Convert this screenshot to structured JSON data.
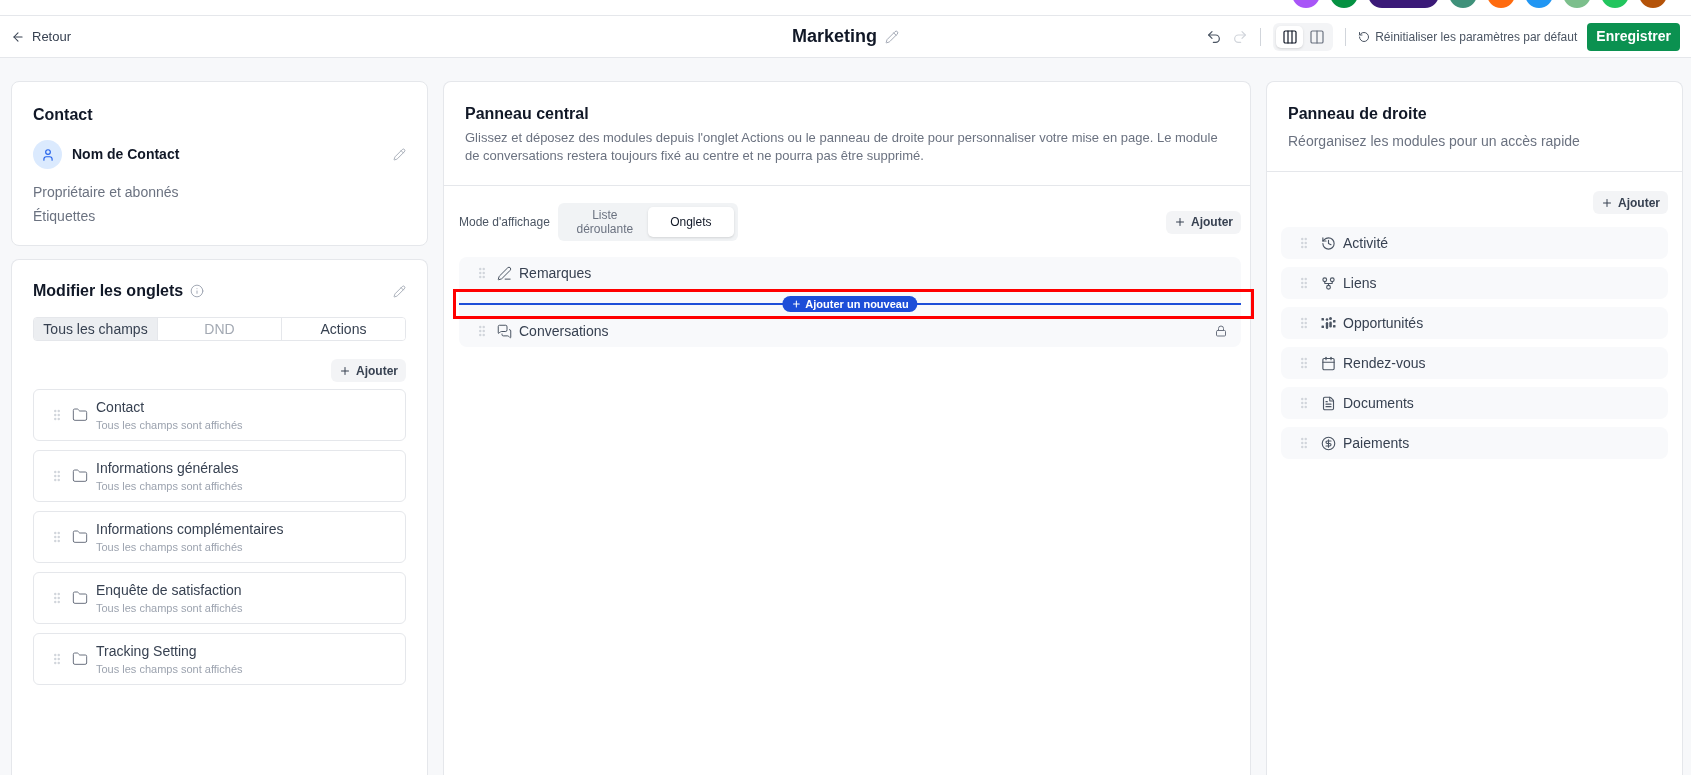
{
  "top_strip": {
    "swatches": [
      {
        "kind": "circle",
        "color": "#a855f7"
      },
      {
        "kind": "circle",
        "color": "#059142"
      },
      {
        "kind": "pill",
        "color": "#3b1a78"
      },
      {
        "kind": "circle",
        "color": "#3f917a"
      },
      {
        "kind": "circle",
        "color": "#ff6b0f"
      },
      {
        "kind": "circle",
        "color": "#2196f3"
      },
      {
        "kind": "circle",
        "color": "#7cbf8c"
      },
      {
        "kind": "circle",
        "color": "#22c55e"
      },
      {
        "kind": "circle",
        "color": "#b45309"
      }
    ]
  },
  "header": {
    "back_label": "Retour",
    "title": "Marketing",
    "history": [
      {
        "kind": "undo",
        "disabled": false
      },
      {
        "kind": "redo",
        "disabled": true
      }
    ],
    "layouts": [
      {
        "kind": "three-columns",
        "selected": true
      },
      {
        "kind": "two-columns",
        "selected": false
      }
    ],
    "reset_label": "Réinitialiser les paramètres par défaut",
    "save_label": "Enregistrer"
  },
  "contact_card": {
    "title": "Contact",
    "name": "Nom de Contact",
    "fields": [
      "Propriétaire et abonnés",
      "Étiquettes"
    ]
  },
  "tabs_card": {
    "title": "Modifier les onglets",
    "tabs": [
      {
        "label": "Tous les champs",
        "selected": true,
        "disabled": false
      },
      {
        "label": "DND",
        "selected": false,
        "disabled": true
      },
      {
        "label": "Actions",
        "selected": false,
        "disabled": false
      }
    ],
    "add_label": "Ajouter",
    "sections": [
      {
        "title": "Contact",
        "subtitle": "Tous les champs sont affichés"
      },
      {
        "title": "Informations générales",
        "subtitle": "Tous les champs sont affichés"
      },
      {
        "title": "Informations complémentaires",
        "subtitle": "Tous les champs sont affichés"
      },
      {
        "title": "Enquête de satisfaction",
        "subtitle": "Tous les champs sont affichés"
      },
      {
        "title": "Tracking Setting",
        "subtitle": "Tous les champs sont affichés"
      }
    ]
  },
  "central_panel": {
    "title": "Panneau central",
    "description": "Glissez et déposez des modules depuis l'onglet Actions ou le panneau de droite pour personnaliser votre mise en page. Le module de conversations restera toujours fixé au centre et ne pourra pas être supprimé.",
    "display_mode_label": "Mode d'affichage",
    "display_modes": [
      {
        "label": "Liste déroulante",
        "selected": false
      },
      {
        "label": "Onglets",
        "selected": true
      }
    ],
    "add_label": "Ajouter",
    "modules": [
      {
        "kind": "notes",
        "label": "Remarques",
        "locked": false
      },
      {
        "kind": "drop-slot",
        "label": "Ajouter un nouveau",
        "highlighted": true
      },
      {
        "kind": "conversations",
        "label": "Conversations",
        "locked": true
      }
    ]
  },
  "right_panel": {
    "title": "Panneau de droite",
    "subtitle": "Réorganisez les modules pour un accès rapide",
    "add_label": "Ajouter",
    "modules": [
      {
        "kind": "activity",
        "label": "Activité"
      },
      {
        "kind": "links",
        "label": "Liens"
      },
      {
        "kind": "opportunities",
        "label": "Opportunités"
      },
      {
        "kind": "appointments",
        "label": "Rendez-vous"
      },
      {
        "kind": "documents",
        "label": "Documents"
      },
      {
        "kind": "payments",
        "label": "Paiements"
      }
    ]
  }
}
